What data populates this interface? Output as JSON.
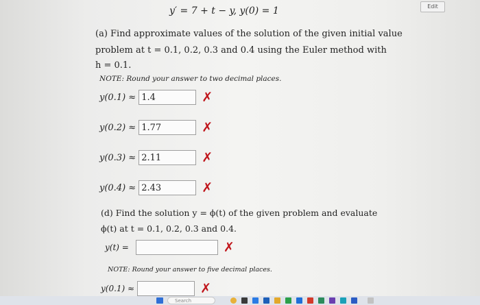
{
  "toolbar": {
    "edit_label": "Edit"
  },
  "problem": {
    "equation": "y′ = 7 + t − y,  y(0) = 1"
  },
  "part_a": {
    "line1": "(a) Find approximate values of the solution of the given initial value",
    "line2": "problem at t = 0.1, 0.2, 0.3 and 0.4 using the Euler method with",
    "line3": "h = 0.1.",
    "note": "NOTE: Round your answer to two decimal places.",
    "answers": [
      {
        "label": "y(0.1) ≈",
        "value": "1.4"
      },
      {
        "label": "y(0.2) ≈",
        "value": "1.77"
      },
      {
        "label": "y(0.3) ≈",
        "value": "2.11"
      },
      {
        "label": "y(0.4) ≈",
        "value": "2.43"
      }
    ]
  },
  "part_d": {
    "line1": "(d) Find the solution y = ϕ(t) of the given problem and evaluate",
    "line2": "ϕ(t) at t = 0.1, 0.2, 0.3 and 0.4.",
    "phi_label": "y(t) =",
    "phi_value": "",
    "note": "NOTE: Round your answer to five decimal places.",
    "first_label": "y(0.1) ≈",
    "first_value": ""
  },
  "status": {
    "incorrect_mark": "✗"
  },
  "taskbar": {
    "search_label": "Search"
  }
}
